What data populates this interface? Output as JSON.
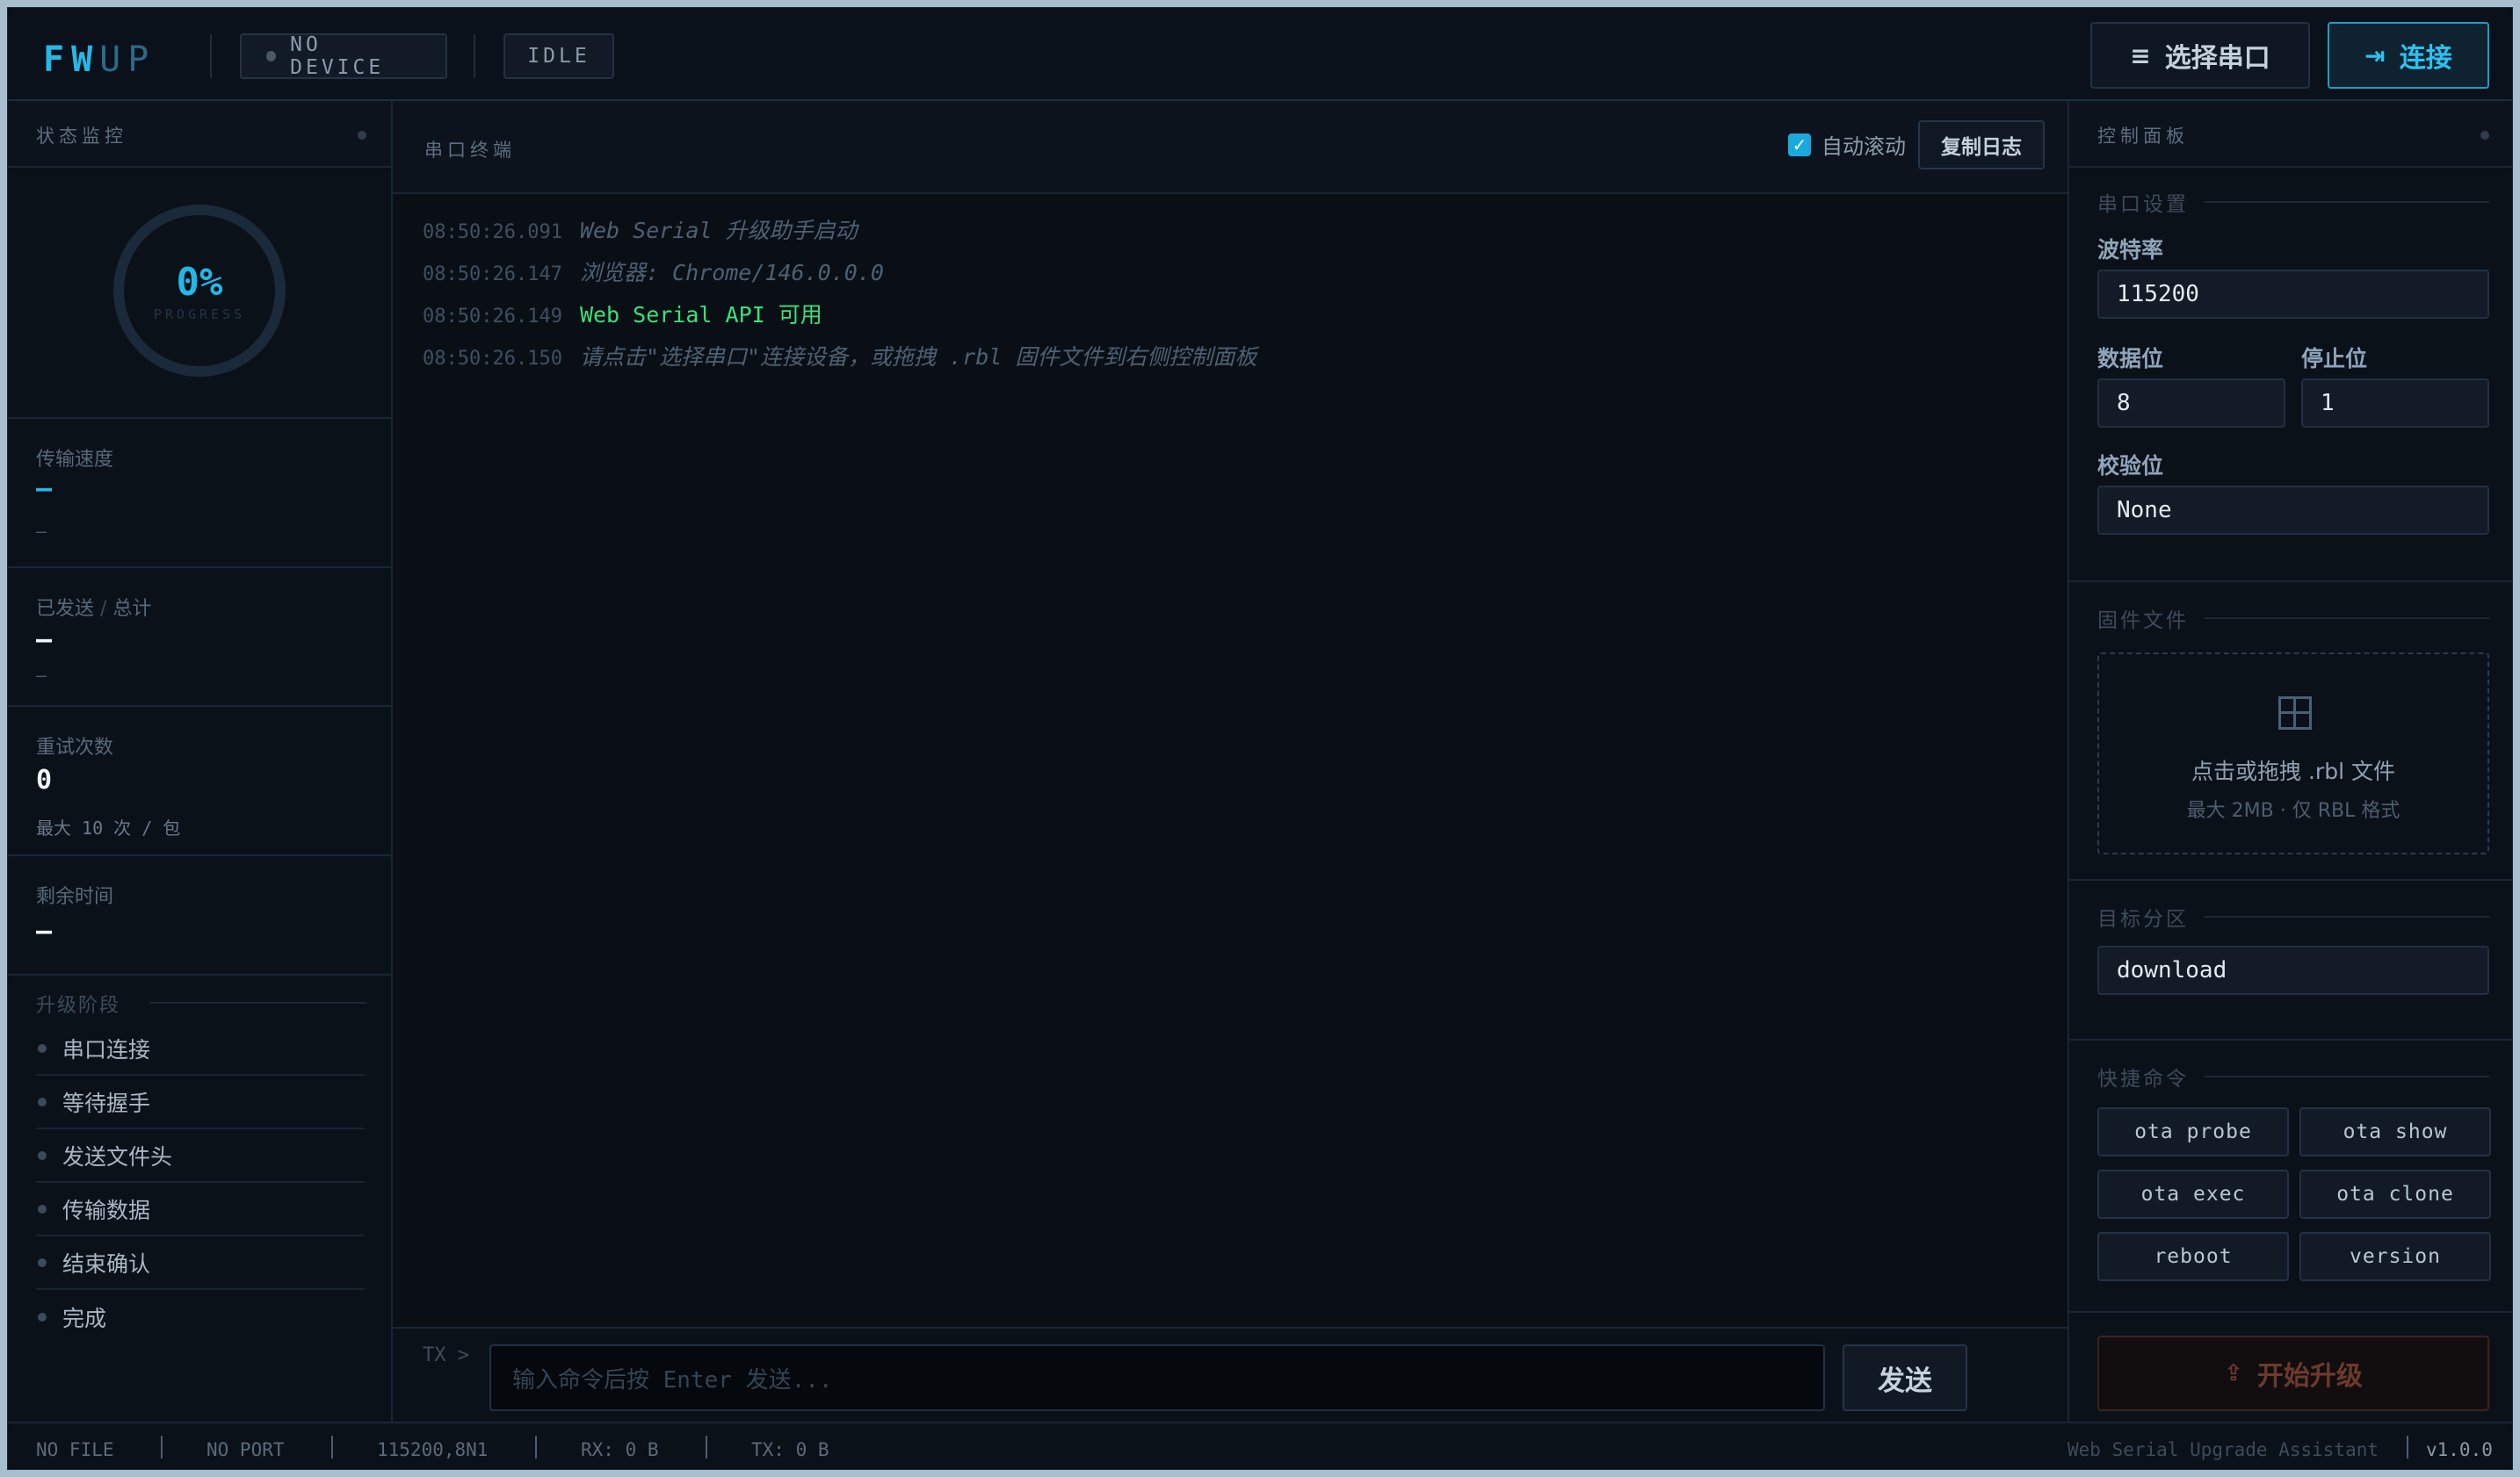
{
  "header": {
    "logo_a": "FW",
    "logo_b": "UP",
    "device_chip": "NO DEVICE",
    "state_chip": "IDLE",
    "select_port_label": "选择串口",
    "connect_label": "连接"
  },
  "left": {
    "title": "状态监控",
    "progress_value": "0%",
    "progress_label": "PROGRESS",
    "speed": {
      "title": "传输速度",
      "value": "—",
      "sub": "—"
    },
    "sent": {
      "title_a": "已发送",
      "title_sep": "/",
      "title_b": "总计",
      "value": "—",
      "sub": "—"
    },
    "retries": {
      "title": "重试次数",
      "value": "0",
      "sub": "最大 10 次 / 包"
    },
    "remaining": {
      "title": "剩余时间",
      "value": "—"
    },
    "stages_title": "升级阶段",
    "stages": [
      "串口连接",
      "等待握手",
      "发送文件头",
      "传输数据",
      "结束确认",
      "完成"
    ]
  },
  "center": {
    "title": "串口终端",
    "autoscroll_label": "自动滚动",
    "autoscroll_checked": true,
    "copy_log_label": "复制日志",
    "logs": [
      {
        "ts": "08:50:26.091",
        "msg": "Web Serial 升级助手启动",
        "kind": "info"
      },
      {
        "ts": "08:50:26.147",
        "msg": "浏览器: Chrome/146.0.0.0",
        "kind": "info"
      },
      {
        "ts": "08:50:26.149",
        "msg": "Web Serial API 可用",
        "kind": "ok"
      },
      {
        "ts": "08:50:26.150",
        "msg": "请点击\"选择串口\"连接设备，或拖拽 .rbl 固件文件到右侧控制面板",
        "kind": "info"
      }
    ],
    "tx_prefix": "TX >",
    "cmd_placeholder": "输入命令后按 Enter 发送...",
    "send_label": "发送"
  },
  "right": {
    "title": "控制面板",
    "serial_title": "串口设置",
    "baud_label": "波特率",
    "baud_value": "115200",
    "databits_label": "数据位",
    "databits_value": "8",
    "stopbits_label": "停止位",
    "stopbits_value": "1",
    "parity_label": "校验位",
    "parity_value": "None",
    "firmware_title": "固件文件",
    "drop_main": "点击或拖拽 .rbl 文件",
    "drop_sub": "最大 2MB · 仅 RBL 格式",
    "target_title": "目标分区",
    "target_value": "download",
    "quick_title": "快捷命令",
    "quick_cmds": [
      "ota probe",
      "ota show",
      "ota exec",
      "ota clone",
      "reboot",
      "version"
    ],
    "upgrade_label": "开始升级"
  },
  "status": {
    "file": "NO FILE",
    "port": "NO PORT",
    "config": "115200,8N1",
    "rx": "RX: 0 B",
    "tx": "TX: 0 B",
    "app_name": "Web Serial Upgrade Assistant",
    "version": "v1.0.0"
  },
  "colors": {
    "accent": "#26b7e6",
    "ok": "#3be07a",
    "background": "#0a0f16"
  },
  "icons": {
    "select_port": "menu-icon",
    "connect": "login-icon",
    "firmware_drop": "grid-icon",
    "upgrade": "upload-icon"
  }
}
